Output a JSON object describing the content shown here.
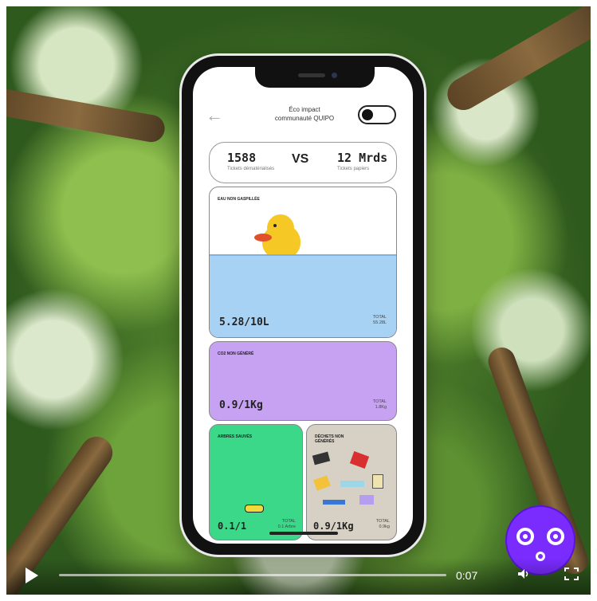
{
  "video": {
    "time": "0:07",
    "icons": [
      "play-icon",
      "volume-icon",
      "fullscreen-icon"
    ]
  },
  "app": {
    "title_line1": "Éco impact",
    "title_line2": "communauté QUIPO",
    "comparison": {
      "left_value": "1588",
      "left_label": "Tickets dématérialisés",
      "vs": "VS",
      "right_value": "12 Mrds",
      "right_label": "Tickets papiers"
    },
    "cards": {
      "water": {
        "label": "EAU NON GASPILLÉE",
        "value": "5.28/10L",
        "total_label": "TOTAL",
        "total_value": "55.28L",
        "color": "#a8d2f3"
      },
      "co2": {
        "label": "CO2 NON GÉNÉRÉ",
        "value": "0.9/1Kg",
        "total_label": "TOTAL",
        "total_value": "1.8Kg",
        "color": "#c7a2f2"
      },
      "trees": {
        "label": "ARBRES SAUVÉS",
        "value": "0.1/1",
        "total_label": "TOTAL",
        "total_value": "0.1 Arbre",
        "color": "#3bd88a"
      },
      "waste": {
        "label": "DÉCHETS NON GÉNÉRÉS",
        "value": "0.9/1Kg",
        "total_label": "TOTAL",
        "total_value": "0.9kg",
        "color": "#d7d0c4"
      }
    }
  },
  "badge": {
    "color": "#7a2cff",
    "icon": "face-icon"
  }
}
